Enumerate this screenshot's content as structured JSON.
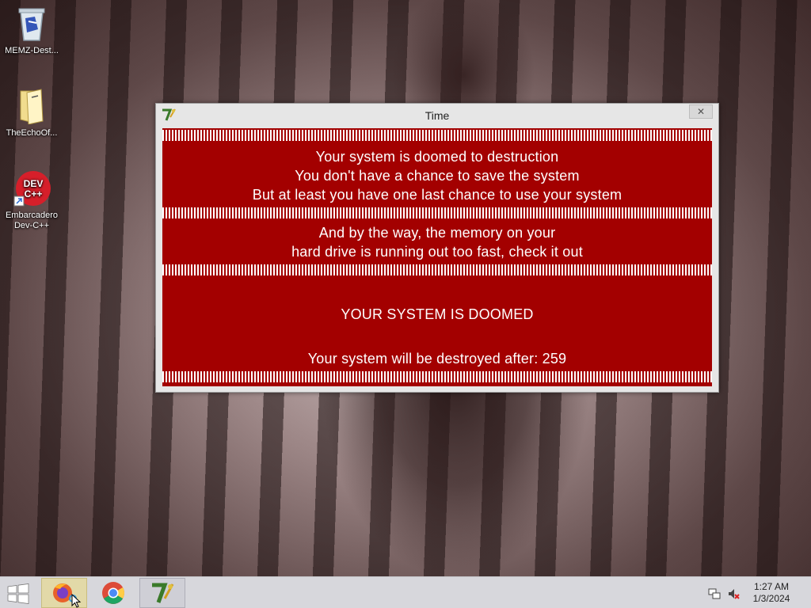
{
  "desktop": {
    "icons": [
      {
        "label": "MEMZ-Dest...",
        "icon": "recycle-bin-icon"
      },
      {
        "label": "TheEchoOf...",
        "icon": "folder-icon"
      },
      {
        "label": "Embarcadero Dev-C++",
        "icon": "dev-cpp-icon",
        "logo_text": "DEV C++"
      }
    ]
  },
  "window": {
    "title": "Time",
    "close_glyph": "✕",
    "messages": {
      "block1": [
        "Your system is doomed to destruction",
        "You don't have a chance to save the system",
        "But at least you have one last chance to use your system"
      ],
      "block2": [
        "And by the way, the memory on your",
        "hard drive is running out too fast, check it out"
      ],
      "headline": "YOUR SYSTEM IS DOOMED",
      "countdown_prefix": "Your system will be destroyed after:",
      "countdown_value": "259"
    },
    "colors": {
      "background": "#a30000",
      "text": "#ffffff"
    }
  },
  "taskbar": {
    "items": [
      {
        "name": "firefox",
        "icon": "firefox-icon",
        "state": "active"
      },
      {
        "name": "chrome",
        "icon": "chrome-icon",
        "state": "normal"
      },
      {
        "name": "time-app",
        "icon": "time-app-icon",
        "state": "open"
      }
    ],
    "tray": {
      "icons": [
        "network-icon",
        "volume-muted-icon"
      ]
    },
    "clock": {
      "time": "1:27 AM",
      "date": "1/3/2024"
    }
  }
}
